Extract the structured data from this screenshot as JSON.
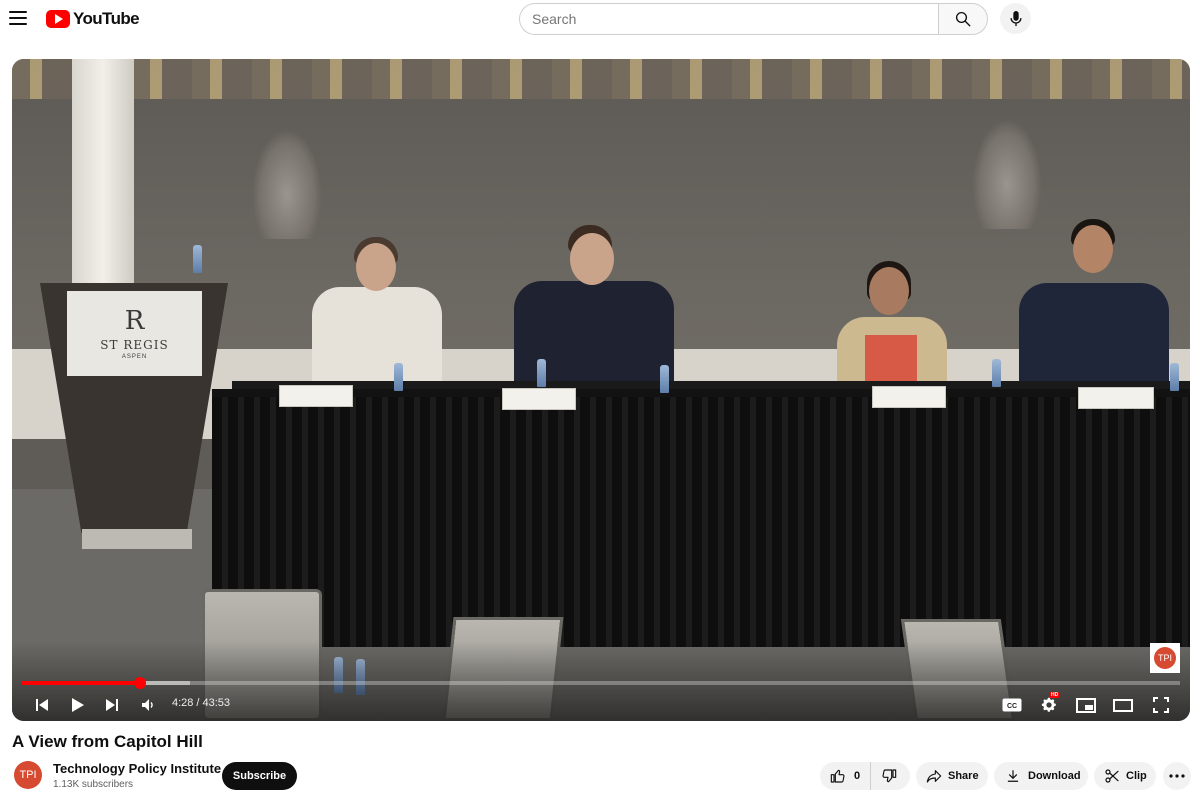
{
  "header": {
    "logo_text": "YouTube",
    "search_placeholder": "Search",
    "icons": [
      "menu-icon",
      "search-icon",
      "mic-icon"
    ]
  },
  "player": {
    "scene": {
      "podium_monogram": "R",
      "podium_name": "ST REGIS",
      "podium_city": "ASPEN"
    },
    "branding_text": "TPI",
    "time_current": "4:28",
    "time_separator": "/",
    "time_total": "43:53",
    "progress_played_fraction": 0.102,
    "progress_buffered_fraction": 0.145,
    "controls_icons": [
      "previous-icon",
      "play-icon",
      "next-icon",
      "volume-icon",
      "captions-icon",
      "settings-icon",
      "hd-badge",
      "miniplayer-icon",
      "theater-icon",
      "fullscreen-icon"
    ],
    "hd_badge_text": "HD"
  },
  "video": {
    "title": "A View from Capitol Hill"
  },
  "channel": {
    "avatar_text": "TPI",
    "name": "Technology Policy Institute",
    "subscribers": "1.13K subscribers",
    "subscribe_label": "Subscribe"
  },
  "actions": {
    "like_count": "0",
    "share_label": "Share",
    "download_label": "Download",
    "clip_label": "Clip",
    "icons": [
      "thumbs-up-icon",
      "thumbs-down-icon",
      "share-icon",
      "download-icon",
      "scissors-icon",
      "more-icon"
    ]
  },
  "colors": {
    "brand_red": "#ff0000",
    "subscribe_bg": "#0f0f0f",
    "pill_bg": "#f2f2f2",
    "channel_avatar": "#d64a32"
  }
}
